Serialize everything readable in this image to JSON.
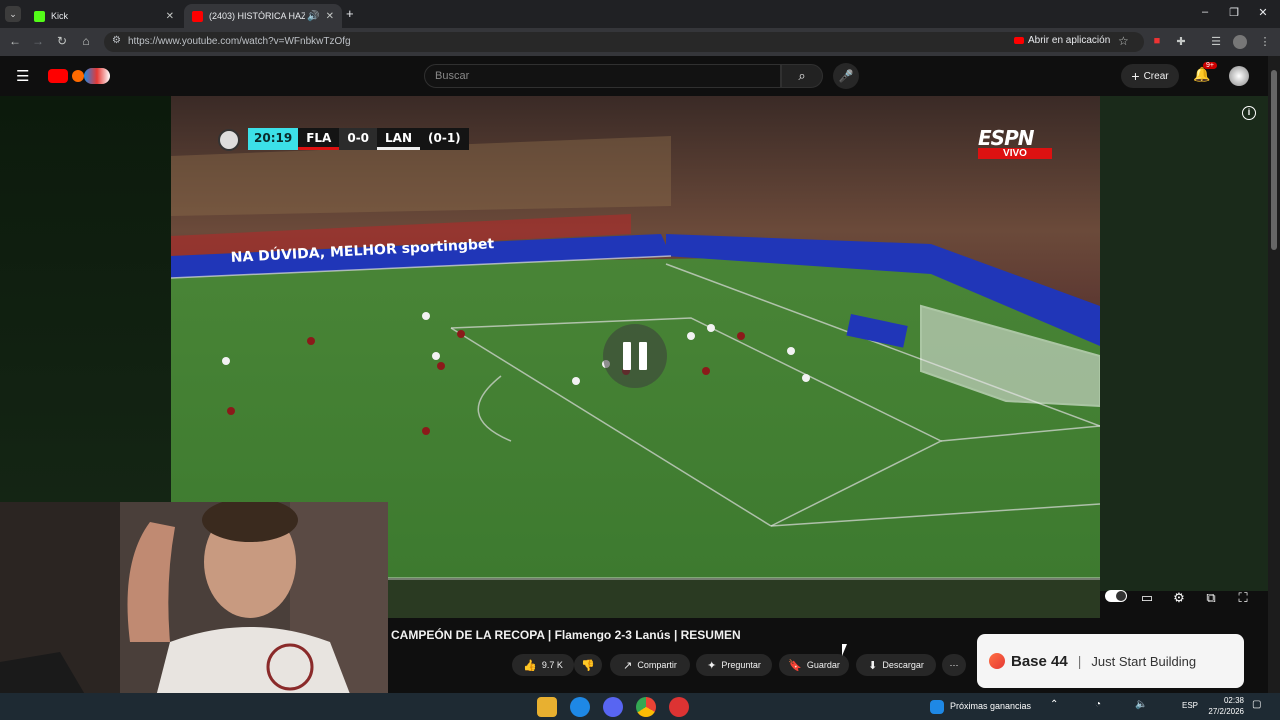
{
  "browser": {
    "tabs": [
      {
        "label": "Kick",
        "active": false
      },
      {
        "label": "(2403) HISTÓRICA HAZAÑ…",
        "active": true
      }
    ],
    "url": "https://www.youtube.com/watch?v=WFnbkwTzOfg",
    "open_in_app": "Abrir en aplicación",
    "window_controls": {
      "minimize": "–",
      "restore": "❐",
      "close": "✕"
    }
  },
  "youtube": {
    "search_placeholder": "Buscar",
    "create_label": "Crear",
    "notifications_badge": "9+"
  },
  "video": {
    "scoreboard": {
      "clock": "20:19",
      "home": "FLA",
      "score": "0-0",
      "away": "LAN",
      "aggregate": "(0-1)"
    },
    "broadcaster": "ESPN",
    "live_label": "VIVO",
    "ads_on_boards": "NA DÚVIDA, MELHOR sportingbet",
    "title": "CAMPEÓN DE LA RECOPA | Flamengo 2-3 Lanús | RESUMEN",
    "progress": 0.0
  },
  "actions": {
    "likes": "9.7 K",
    "share": "Compartir",
    "ask": "Preguntar",
    "save": "Guardar",
    "download": "Descargar",
    "more": "⋯"
  },
  "ad": {
    "brand": "Base 44",
    "separator": "|",
    "tagline": "Just Start Building"
  },
  "taskbar": {
    "widget_text": "Próximas ganancias",
    "language": "ESP",
    "time": "02:38",
    "date": "27/2/2026"
  }
}
